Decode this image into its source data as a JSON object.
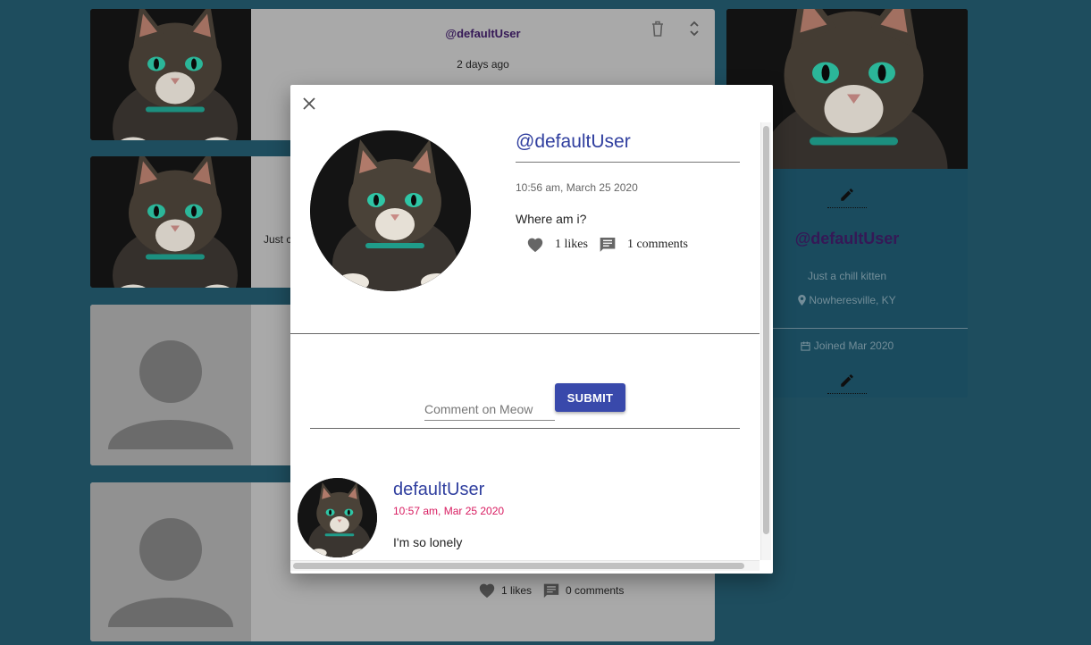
{
  "feed": {
    "cards": [
      {
        "type": "cat",
        "user": "@defaultUser",
        "time": "2 days ago"
      },
      {
        "type": "cat",
        "text_fragment": "Just c"
      },
      {
        "type": "blank"
      },
      {
        "type": "blank",
        "likes": "1 likes",
        "comments": "0 comments"
      }
    ]
  },
  "profile": {
    "handle": "@defaultUser",
    "bio": "Just a chill kitten",
    "location": "Nowheresville, KY",
    "joined": "Joined Mar 2020"
  },
  "modal": {
    "post": {
      "handle": "@defaultUser",
      "time": "10:56 am, March 25 2020",
      "text": "Where am i?",
      "likes": "1 likes",
      "comments": "1 comments"
    },
    "comment_placeholder": "Comment on Meow",
    "submit_label": "SUBMIT",
    "comment": {
      "user": "defaultUser",
      "time": "10:57 am, Mar 25 2020",
      "text": "I'm so lonely"
    }
  },
  "colors": {
    "page_bg": "#215466",
    "accent": "#303f9f",
    "submit_bg": "#3949ab",
    "comment_time": "#d81b60",
    "handle_purple": "#3a1b5e"
  },
  "icons": [
    "close-icon",
    "trash-icon",
    "expand-icon",
    "heart-icon",
    "comment-icon",
    "pencil-icon",
    "location-pin-icon",
    "calendar-icon"
  ]
}
